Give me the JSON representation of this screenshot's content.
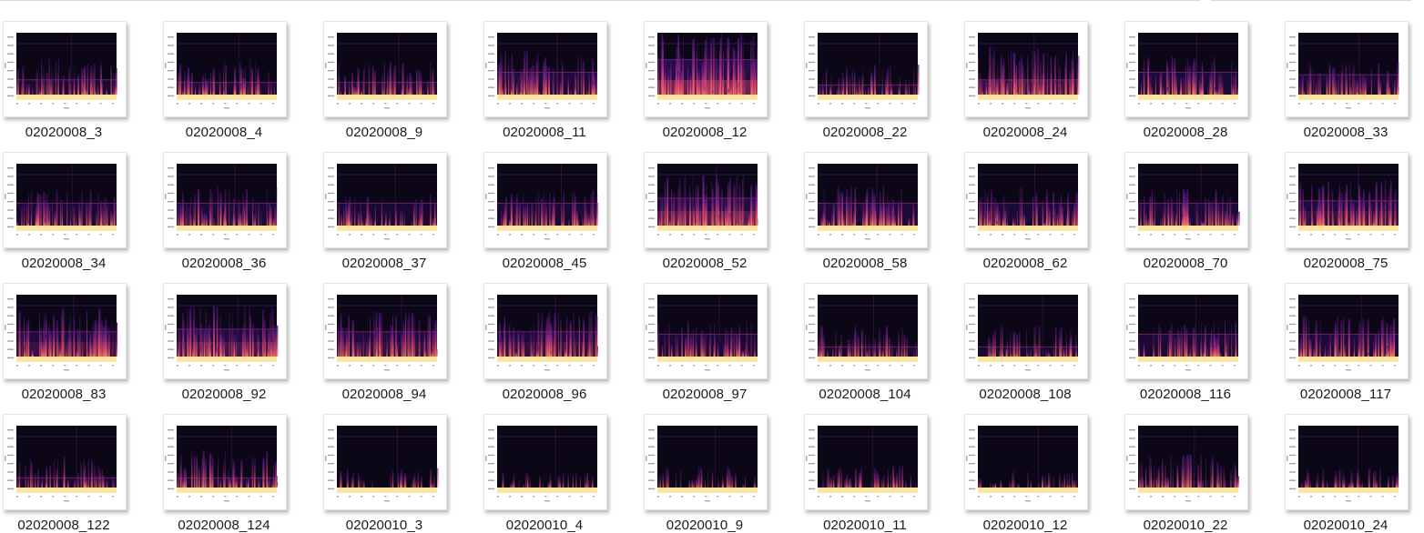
{
  "window": {
    "view": "large-icons"
  },
  "files": [
    {
      "name": "02020008_3",
      "intensity": 0.45,
      "band": 0.4
    },
    {
      "name": "02020008_4",
      "intensity": 0.45,
      "band": 0.35
    },
    {
      "name": "02020008_9",
      "intensity": 0.4,
      "band": 0.35
    },
    {
      "name": "02020008_11",
      "intensity": 0.6,
      "band": 0.55
    },
    {
      "name": "02020008_12",
      "intensity": 0.95,
      "band": 0.8
    },
    {
      "name": "02020008_22",
      "intensity": 0.35,
      "band": 0.3
    },
    {
      "name": "02020008_24",
      "intensity": 0.7,
      "band": 0.4
    },
    {
      "name": "02020008_28",
      "intensity": 0.5,
      "band": 0.55
    },
    {
      "name": "02020008_33",
      "intensity": 0.4,
      "band": 0.5
    },
    {
      "name": "02020008_34",
      "intensity": 0.45,
      "band": 0.55
    },
    {
      "name": "02020008_36",
      "intensity": 0.5,
      "band": 0.55
    },
    {
      "name": "02020008_37",
      "intensity": 0.35,
      "band": 0.55
    },
    {
      "name": "02020008_45",
      "intensity": 0.45,
      "band": 0.55
    },
    {
      "name": "02020008_52",
      "intensity": 0.8,
      "band": 0.65
    },
    {
      "name": "02020008_58",
      "intensity": 0.55,
      "band": 0.55
    },
    {
      "name": "02020008_62",
      "intensity": 0.5,
      "band": 0.55
    },
    {
      "name": "02020008_70",
      "intensity": 0.5,
      "band": 0.55
    },
    {
      "name": "02020008_75",
      "intensity": 0.65,
      "band": 0.6
    },
    {
      "name": "02020008_83",
      "intensity": 0.7,
      "band": 0.6
    },
    {
      "name": "02020008_92",
      "intensity": 0.75,
      "band": 0.65
    },
    {
      "name": "02020008_94",
      "intensity": 0.65,
      "band": 0.6
    },
    {
      "name": "02020008_96",
      "intensity": 0.65,
      "band": 0.6
    },
    {
      "name": "02020008_97",
      "intensity": 0.45,
      "band": 0.55
    },
    {
      "name": "02020008_104",
      "intensity": 0.35,
      "band": 0.3
    },
    {
      "name": "02020008_108",
      "intensity": 0.35,
      "band": 0.3
    },
    {
      "name": "02020008_116",
      "intensity": 0.45,
      "band": 0.55
    },
    {
      "name": "02020008_117",
      "intensity": 0.55,
      "band": 0.55
    },
    {
      "name": "02020008_122",
      "intensity": 0.35,
      "band": 0.3
    },
    {
      "name": "02020008_124",
      "intensity": 0.5,
      "band": 0.3
    },
    {
      "name": "02020010_3",
      "intensity": 0.12,
      "band": 0.1
    },
    {
      "name": "02020010_4",
      "intensity": 0.05,
      "band": 0.05
    },
    {
      "name": "02020010_9",
      "intensity": 0.15,
      "band": 0.1
    },
    {
      "name": "02020010_11",
      "intensity": 0.18,
      "band": 0.2
    },
    {
      "name": "02020010_12",
      "intensity": 0.08,
      "band": 0.05
    },
    {
      "name": "02020010_22",
      "intensity": 0.4,
      "band": 0.25
    },
    {
      "name": "02020010_24",
      "intensity": 0.18,
      "band": 0.2
    }
  ],
  "thumbnail_colors": {
    "background": "#0b0716",
    "bottom_band": "#fde6a4",
    "low": "#3b0f6b",
    "mid": "#8c2981",
    "high": "#de4968",
    "peak": "#fb8761",
    "line": "#4a1e6b",
    "axis_text": "#555555"
  }
}
